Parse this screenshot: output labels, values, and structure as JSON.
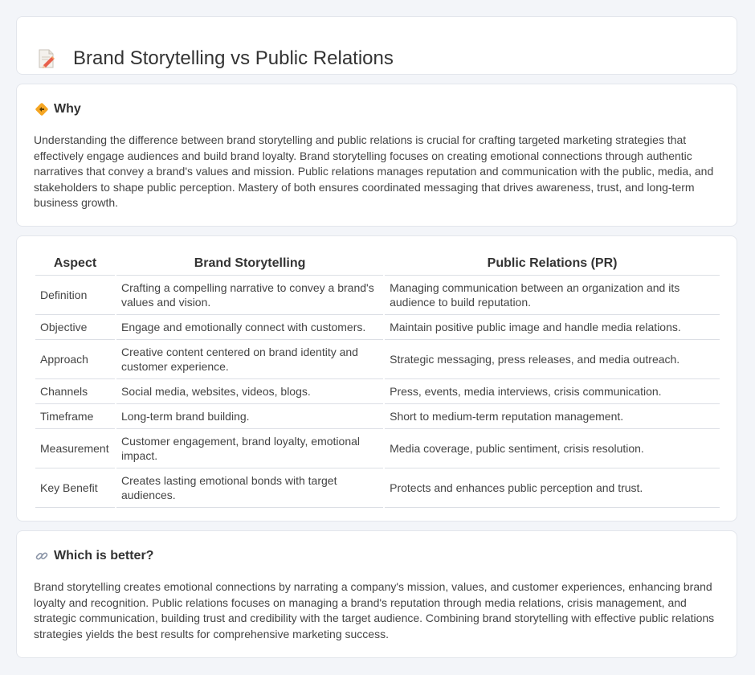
{
  "header": {
    "title": "Brand Storytelling vs Public Relations",
    "icon": "document-pencil-icon"
  },
  "why": {
    "heading": "Why",
    "icon": "diamond-arrows-icon",
    "body": "Understanding the difference between brand storytelling and public relations is crucial for crafting targeted marketing strategies that effectively engage audiences and build brand loyalty. Brand storytelling focuses on creating emotional connections through authentic narratives that convey a brand's values and mission. Public relations manages reputation and communication with the public, media, and stakeholders to shape public perception. Mastery of both ensures coordinated messaging that drives awareness, trust, and long-term business growth."
  },
  "table": {
    "headers": [
      "Aspect",
      "Brand Storytelling",
      "Public Relations (PR)"
    ],
    "rows": [
      [
        "Definition",
        "Crafting a compelling narrative to convey a brand's values and vision.",
        "Managing communication between an organization and its audience to build reputation."
      ],
      [
        "Objective",
        "Engage and emotionally connect with customers.",
        "Maintain positive public image and handle media relations."
      ],
      [
        "Approach",
        "Creative content centered on brand identity and customer experience.",
        "Strategic messaging, press releases, and media outreach."
      ],
      [
        "Channels",
        "Social media, websites, videos, blogs.",
        "Press, events, media interviews, crisis communication."
      ],
      [
        "Timeframe",
        "Long-term brand building.",
        "Short to medium-term reputation management."
      ],
      [
        "Measurement",
        "Customer engagement, brand loyalty, emotional impact.",
        "Media coverage, public sentiment, crisis resolution."
      ],
      [
        "Key Benefit",
        "Creates lasting emotional bonds with target audiences.",
        "Protects and enhances public perception and trust."
      ]
    ]
  },
  "better": {
    "heading": "Which is better?",
    "icon": "link-icon",
    "body": "Brand storytelling creates emotional connections by narrating a company's mission, values, and customer experiences, enhancing brand loyalty and recognition. Public relations focuses on managing a brand's reputation through media relations, crisis management, and strategic communication, building trust and credibility with the target audience. Combining brand storytelling with effective public relations strategies yields the best results for comprehensive marketing success."
  }
}
